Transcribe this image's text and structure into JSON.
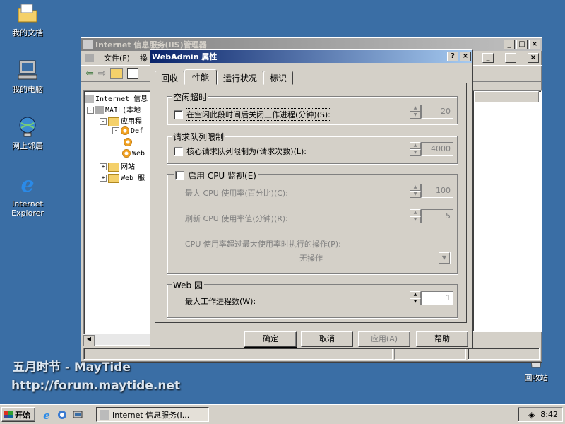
{
  "desktop": {
    "icons": [
      {
        "label": "我的文档"
      },
      {
        "label": "我的电脑"
      },
      {
        "label": "网上邻居"
      },
      {
        "label": "Internet\nExplorer"
      },
      {
        "label": "回收站"
      }
    ]
  },
  "iis": {
    "title": "Internet 信息服务(IIS)管理器",
    "menu": [
      "文件(F)",
      "操"
    ],
    "tree": [
      {
        "label": "Internet 信息"
      },
      {
        "label": "MAIL(本地"
      },
      {
        "label": "应用程"
      },
      {
        "label": "Def"
      },
      {
        "label": "Web"
      },
      {
        "label": "网站"
      },
      {
        "label": "Web 服"
      }
    ]
  },
  "dialog": {
    "title": "WebAdmin 属性",
    "help_btn": "?",
    "close_btn": "×",
    "tabs": [
      "回收",
      "性能",
      "运行状况",
      "标识"
    ],
    "active_tab": 1,
    "idle": {
      "group": "空闲超时",
      "checkbox": "在空闲此段时间后关闭工作进程(分钟)(S):",
      "value": "20"
    },
    "queue": {
      "group": "请求队列限制",
      "checkbox": "核心请求队列限制为(请求次数)(L):",
      "value": "4000"
    },
    "cpu": {
      "group": "启用 CPU 监视(E)",
      "max_label": "最大 CPU 使用率(百分比)(C):",
      "max_value": "100",
      "refresh_label": "刷新 CPU 使用率值(分钟)(R):",
      "refresh_value": "5",
      "action_label": "CPU 使用率超过最大使用率时执行的操作(P):",
      "action_value": "无操作"
    },
    "garden": {
      "group": "Web 园",
      "label": "最大工作进程数(W):",
      "value": "1"
    },
    "buttons": {
      "ok": "确定",
      "cancel": "取消",
      "apply": "应用(A)",
      "help": "帮助"
    }
  },
  "taskbar": {
    "start": "开始",
    "task": "Internet 信息服务(I...",
    "clock": "8:42"
  },
  "watermark": {
    "line1": "五月时节 - MayTide",
    "line2": "http://forum.maytide.net"
  }
}
